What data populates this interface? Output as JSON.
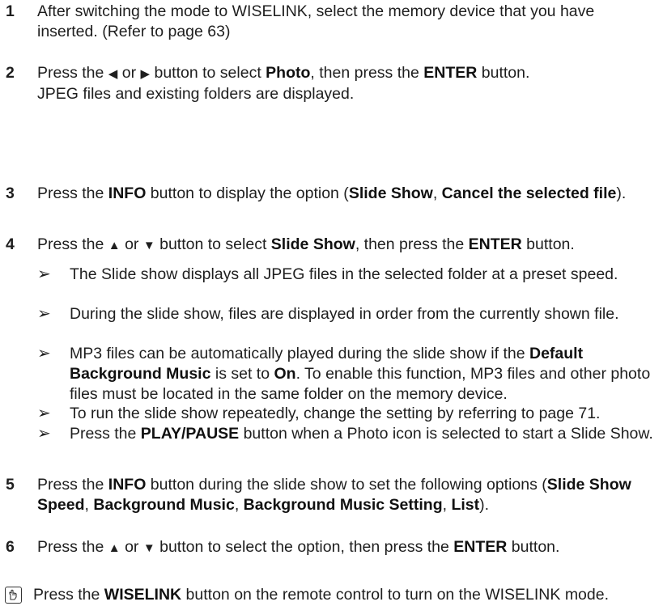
{
  "steps": [
    {
      "num": "1",
      "parts": [
        {
          "t": "After switching the mode to WISELINK, select the memory device that you have inserted. (Refer to page 63)"
        }
      ]
    },
    {
      "num": "2",
      "parts": [
        {
          "t": "Press the "
        },
        {
          "t": "◀",
          "sym": 1
        },
        {
          "t": " or "
        },
        {
          "t": "▶",
          "sym": 1
        },
        {
          "t": " button to select "
        },
        {
          "t": "Photo",
          "b": 1
        },
        {
          "t": ", then press the "
        },
        {
          "t": "ENTER",
          "b": 1
        },
        {
          "t": " button."
        },
        {
          "br": 1
        },
        {
          "t": "JPEG files and existing folders are displayed."
        }
      ]
    },
    {
      "num": "3",
      "parts": [
        {
          "t": "Press the "
        },
        {
          "t": "INFO",
          "b": 1
        },
        {
          "t": " button to display the option ("
        },
        {
          "t": "Slide Show",
          "b": 1
        },
        {
          "t": ", "
        },
        {
          "t": "Cancel the selected file",
          "b": 1
        },
        {
          "t": ")."
        }
      ]
    },
    {
      "num": "4",
      "parts": [
        {
          "t": "Press the "
        },
        {
          "t": "▲",
          "sym": 1
        },
        {
          "t": " or "
        },
        {
          "t": "▼",
          "sym": 1
        },
        {
          "t": " button to select "
        },
        {
          "t": "Slide Show",
          "b": 1
        },
        {
          "t": ", then press the "
        },
        {
          "t": "ENTER",
          "b": 1
        },
        {
          "t": " button."
        }
      ]
    },
    {
      "num": "5",
      "parts": [
        {
          "t": "Press the "
        },
        {
          "t": "INFO",
          "b": 1
        },
        {
          "t": " button during the slide show to set the following options ("
        },
        {
          "t": "Slide Show Speed",
          "b": 1
        },
        {
          "t": ", "
        },
        {
          "t": "Background Music",
          "b": 1
        },
        {
          "t": ", "
        },
        {
          "t": "Background Music Setting",
          "b": 1
        },
        {
          "t": ", "
        },
        {
          "t": "List",
          "b": 1
        },
        {
          "t": ")."
        }
      ]
    },
    {
      "num": "6",
      "parts": [
        {
          "t": "Press the "
        },
        {
          "t": "▲",
          "sym": 1
        },
        {
          "t": " or "
        },
        {
          "t": "▼",
          "sym": 1
        },
        {
          "t": " button to select the option, then press the "
        },
        {
          "t": "ENTER",
          "b": 1
        },
        {
          "t": " button."
        }
      ]
    }
  ],
  "notes": [
    {
      "arrow": "➢",
      "parts": [
        {
          "t": "The Slide show displays all JPEG files in the selected folder at a preset speed."
        }
      ]
    },
    {
      "arrow": "➢",
      "parts": [
        {
          "t": "During the slide show, files are displayed in order from the currently shown file."
        }
      ]
    },
    {
      "arrow": "➢",
      "parts": [
        {
          "t": "MP3 files can be automatically played during the slide show if the "
        },
        {
          "t": "Default Background Music",
          "b": 1
        },
        {
          "t": " is set to "
        },
        {
          "t": "On",
          "b": 1
        },
        {
          "t": ". To enable this function, MP3 files and other photo files must be located in the same folder on the memory device."
        }
      ]
    },
    {
      "arrow": "➢",
      "parts": [
        {
          "t": "To run the slide show repeatedly, change the setting by referring to page 71."
        }
      ]
    },
    {
      "arrow": "➢",
      "parts": [
        {
          "t": "Press the "
        },
        {
          "t": "PLAY/PAUSE",
          "b": 1
        },
        {
          "t": " button when a Photo icon is selected to start a Slide Show."
        }
      ]
    }
  ],
  "footer": {
    "icon": "remote-hand-icon",
    "parts": [
      {
        "t": "Press the "
      },
      {
        "t": "WISELINK",
        "b": 1
      },
      {
        "t": " button on the remote control to turn on the WISELINK mode."
      }
    ]
  }
}
